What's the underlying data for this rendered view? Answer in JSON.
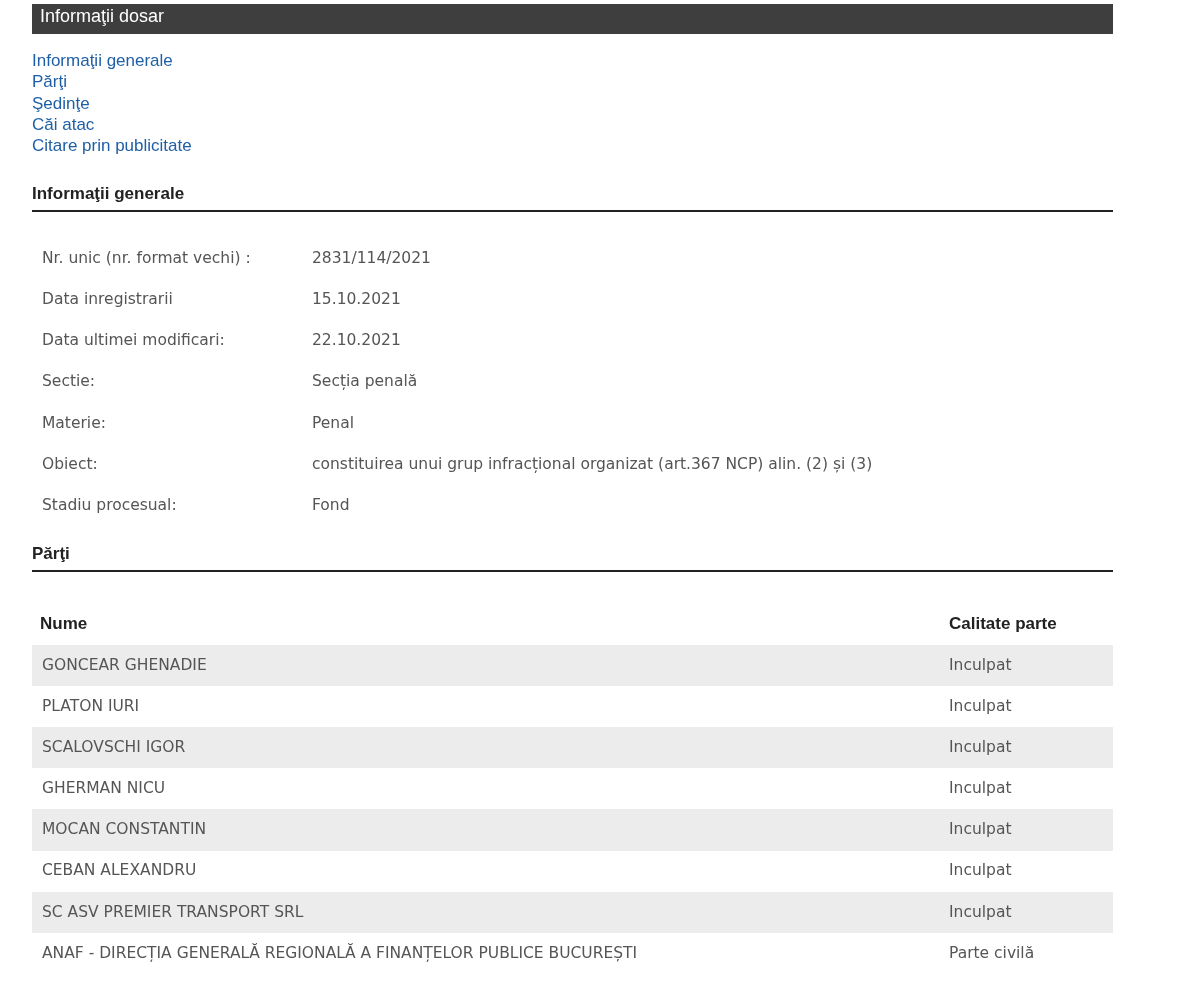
{
  "header": {
    "title": "Informaţii dosar"
  },
  "nav_links": [
    "Informaţii generale",
    "Părţi",
    "Şedinţe",
    "Căi atac",
    "Citare prin publicitate"
  ],
  "general_info": {
    "heading": "Informaţii generale",
    "fields": [
      {
        "label": "Nr. unic (nr. format vechi) :",
        "value": "2831/114/2021"
      },
      {
        "label": "Data inregistrarii",
        "value": "15.10.2021"
      },
      {
        "label": "Data ultimei modificari:",
        "value": "22.10.2021"
      },
      {
        "label": "Sectie:",
        "value": "Secția penală"
      },
      {
        "label": "Materie:",
        "value": "Penal"
      },
      {
        "label": "Obiect:",
        "value": "constituirea unui grup infracțional organizat (art.367 NCP) alin. (2) și (3)"
      },
      {
        "label": "Stadiu procesual:",
        "value": "Fond"
      }
    ]
  },
  "parties": {
    "heading": "Părţi",
    "columns": [
      "Nume",
      "Calitate parte"
    ],
    "rows": [
      [
        "GONCEAR GHENADIE",
        "Inculpat"
      ],
      [
        "PLATON IURI",
        "Inculpat"
      ],
      [
        "SCALOVSCHI IGOR",
        "Inculpat"
      ],
      [
        "GHERMAN NICU",
        "Inculpat"
      ],
      [
        "MOCAN CONSTANTIN",
        "Inculpat"
      ],
      [
        "CEBAN ALEXANDRU",
        "Inculpat"
      ],
      [
        "SC ASV PREMIER TRANSPORT SRL",
        "Inculpat"
      ],
      [
        "ANAF - DIRECȚIA GENERALĂ REGIONALĂ A FINANȚELOR PUBLICE BUCUREȘTI",
        "Parte civilă"
      ]
    ]
  }
}
